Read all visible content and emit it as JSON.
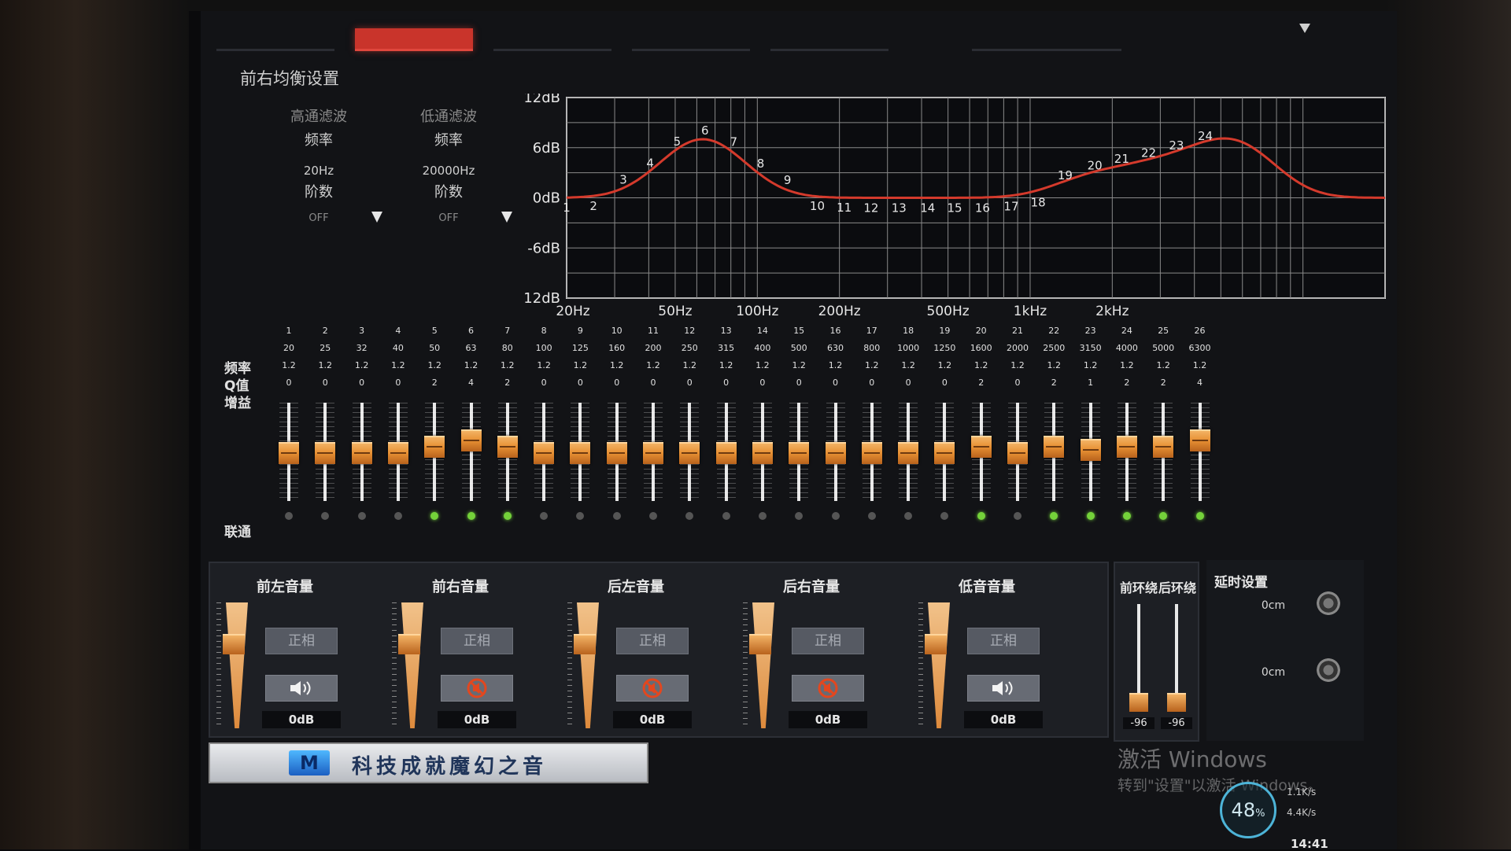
{
  "section_title": "前右均衡设置",
  "highpass": {
    "title": "高通滤波",
    "freq_label": "频率",
    "freq_value": "20Hz",
    "order_label": "阶数",
    "order_value": "OFF"
  },
  "lowpass": {
    "title": "低通滤波",
    "freq_label": "频率",
    "freq_value": "20000Hz",
    "order_label": "阶数",
    "order_value": "OFF"
  },
  "chart_data": {
    "type": "line",
    "y_ticks": [
      "12dB",
      "6dB",
      "0dB",
      "-6dB",
      "-12dB"
    ],
    "x_ticks": [
      "20Hz",
      "50Hz",
      "100Hz",
      "200Hz",
      "500Hz",
      "1kHz",
      "2kHz"
    ],
    "ylim": [
      -12,
      12
    ],
    "xlim_hz": [
      20,
      20000
    ],
    "x_scale": "log",
    "grid": true,
    "line_color": "#d43a2c",
    "band_markers": [
      "1",
      "2",
      "3",
      "4",
      "5",
      "6",
      "7",
      "8",
      "9",
      "10",
      "11",
      "12",
      "13",
      "14",
      "15",
      "16",
      "17",
      "18",
      "19",
      "20",
      "21",
      "22",
      "23",
      "24"
    ]
  },
  "row_labels": {
    "freq": "频率",
    "q": "Q值",
    "gain": "增益",
    "link": "联通"
  },
  "bands": [
    {
      "n": "1",
      "f": "20",
      "q": "1.2",
      "g": "0",
      "on": false
    },
    {
      "n": "2",
      "f": "25",
      "q": "1.2",
      "g": "0",
      "on": false
    },
    {
      "n": "3",
      "f": "32",
      "q": "1.2",
      "g": "0",
      "on": false
    },
    {
      "n": "4",
      "f": "40",
      "q": "1.2",
      "g": "0",
      "on": false
    },
    {
      "n": "5",
      "f": "50",
      "q": "1.2",
      "g": "2",
      "on": true
    },
    {
      "n": "6",
      "f": "63",
      "q": "1.2",
      "g": "4",
      "on": true
    },
    {
      "n": "7",
      "f": "80",
      "q": "1.2",
      "g": "2",
      "on": true
    },
    {
      "n": "8",
      "f": "100",
      "q": "1.2",
      "g": "0",
      "on": false
    },
    {
      "n": "9",
      "f": "125",
      "q": "1.2",
      "g": "0",
      "on": false
    },
    {
      "n": "10",
      "f": "160",
      "q": "1.2",
      "g": "0",
      "on": false
    },
    {
      "n": "11",
      "f": "200",
      "q": "1.2",
      "g": "0",
      "on": false
    },
    {
      "n": "12",
      "f": "250",
      "q": "1.2",
      "g": "0",
      "on": false
    },
    {
      "n": "13",
      "f": "315",
      "q": "1.2",
      "g": "0",
      "on": false
    },
    {
      "n": "14",
      "f": "400",
      "q": "1.2",
      "g": "0",
      "on": false
    },
    {
      "n": "15",
      "f": "500",
      "q": "1.2",
      "g": "0",
      "on": false
    },
    {
      "n": "16",
      "f": "630",
      "q": "1.2",
      "g": "0",
      "on": false
    },
    {
      "n": "17",
      "f": "800",
      "q": "1.2",
      "g": "0",
      "on": false
    },
    {
      "n": "18",
      "f": "1000",
      "q": "1.2",
      "g": "0",
      "on": false
    },
    {
      "n": "19",
      "f": "1250",
      "q": "1.2",
      "g": "0",
      "on": false
    },
    {
      "n": "20",
      "f": "1600",
      "q": "1.2",
      "g": "2",
      "on": true
    },
    {
      "n": "21",
      "f": "2000",
      "q": "1.2",
      "g": "0",
      "on": false
    },
    {
      "n": "22",
      "f": "2500",
      "q": "1.2",
      "g": "2",
      "on": true
    },
    {
      "n": "23",
      "f": "3150",
      "q": "1.2",
      "g": "1",
      "on": true
    },
    {
      "n": "24",
      "f": "4000",
      "q": "1.2",
      "g": "2",
      "on": true
    },
    {
      "n": "25",
      "f": "5000",
      "q": "1.2",
      "g": "2",
      "on": true
    },
    {
      "n": "26",
      "f": "6300",
      "q": "1.2",
      "g": "4",
      "on": true
    }
  ],
  "channels": [
    {
      "key": "fl",
      "title": "前左音量",
      "phase": "正相",
      "muted": false,
      "db": "0dB",
      "level": 0.75
    },
    {
      "key": "fr",
      "title": "前右音量",
      "phase": "正相",
      "muted": true,
      "db": "0dB",
      "level": 0.75
    },
    {
      "key": "rl",
      "title": "后左音量",
      "phase": "正相",
      "muted": true,
      "db": "0dB",
      "level": 0.75
    },
    {
      "key": "rr",
      "title": "后右音量",
      "phase": "正相",
      "muted": true,
      "db": "0dB",
      "level": 0.75
    },
    {
      "key": "sub",
      "title": "低音音量",
      "phase": "正相",
      "muted": false,
      "db": "0dB",
      "level": 0.75
    }
  ],
  "surround": {
    "front_title": "前环绕",
    "rear_title": "后环绕",
    "front_value": "-96",
    "rear_value": "-96"
  },
  "delay": {
    "title": "延时设置",
    "value_1": "0cm",
    "value_2": "0cm"
  },
  "brand": {
    "logo_text": "M",
    "slogan": "科技成就魔幻之音"
  },
  "windows": {
    "activate_line1": "激活 Windows",
    "activate_line2": "转到\"设置\"以激活 Windows。"
  },
  "net": {
    "percent": "48",
    "unit": "%",
    "up": "1.1K/s",
    "down": "4.4K/s"
  },
  "clock": "14:41",
  "colors": {
    "accent": "#c9342b",
    "knob": "#e89134",
    "link_on": "#74d23a",
    "curve": "#d43a2c"
  }
}
